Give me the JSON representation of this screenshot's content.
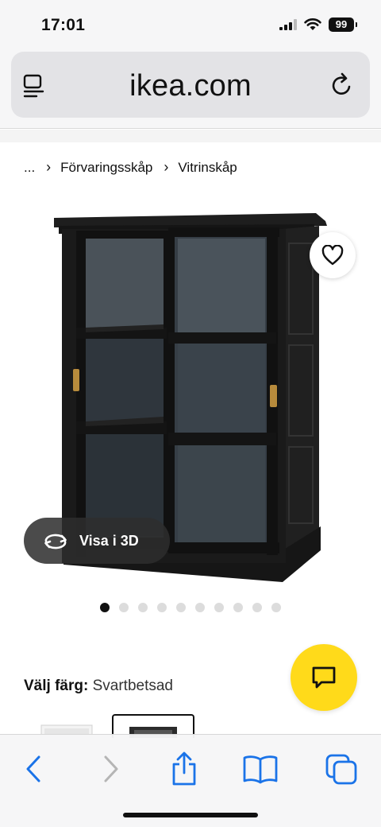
{
  "status_bar": {
    "time": "17:01",
    "battery": "99",
    "icons": [
      "signal-icon",
      "wifi-icon",
      "battery-icon"
    ]
  },
  "browser": {
    "url": "ikea.com",
    "icons": {
      "reader": "reader-icon",
      "reload": "reload-icon"
    }
  },
  "breadcrumb": {
    "items": [
      "...",
      "Förvaringsskåp",
      "Vitrinskåp"
    ],
    "separator": "›"
  },
  "product": {
    "image": "glass-door-cabinet-black",
    "view3d_label": "Visa i 3D",
    "carousel": {
      "total": 10,
      "active": 1
    },
    "icons": {
      "favorite": "heart-icon",
      "rotate": "rotate-3d-icon"
    }
  },
  "color": {
    "label": "Välj färg:",
    "value": "Svartbetsad",
    "swatches": [
      "white",
      "black-brown"
    ]
  },
  "chat": {
    "icon": "chat-icon",
    "color": "#FFDA1A"
  },
  "toolbar": {
    "accent": "#1A73E8",
    "items": [
      "back-icon",
      "forward-icon",
      "share-icon",
      "bookmarks-icon",
      "tabs-icon"
    ]
  }
}
